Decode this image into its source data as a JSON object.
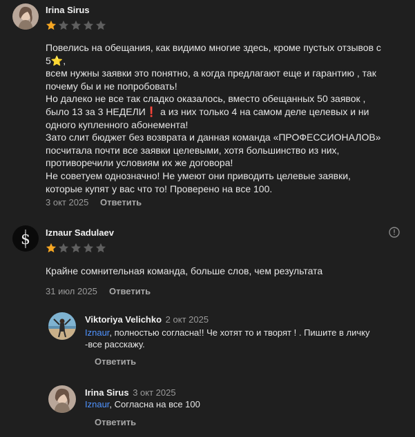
{
  "reviews": [
    {
      "author": "Irina Sirus",
      "rating": 1,
      "max_rating": 5,
      "lines": [
        "Повелись на обещания, как видимо многие здесь, кроме пустых отзывов с",
        "5⭐,",
        "всем нужны заявки это понятно, а когда предлагают еще и гарантию , так",
        "почему бы и не попробовать!",
        "Но далеко не все так сладко оказалось, вместо обещанных 50 заявок ,",
        "было 13 за 3 НЕДЕЛИ❗ а из них только 4 на самом деле целевых и ни",
        "одного купленного абонемента!",
        "Зато слит бюджет без возврата и данная команда «ПРОФЕССИОНАЛОВ»",
        "посчитала почти все заявки целевыми, хотя большинство из них,",
        "противоречили условиям их же договора!",
        "Не советуем однозначно! Не умеют они приводить целевые заявки,",
        "которые купят у вас что то! Проверено на все 100."
      ],
      "date": "3 окт 2025",
      "reply_label": "Ответить"
    },
    {
      "author": "Iznaur Sadulaev",
      "rating": 1,
      "max_rating": 5,
      "text": "Крайне сомнительная команда, больше слов, чем результата",
      "date": "31 июл 2025",
      "reply_label": "Ответить",
      "info_icon": "info-icon",
      "replies": [
        {
          "author": "Viktoriya Velichko",
          "date": "2 окт 2025",
          "mention": "Iznaur",
          "text": ", полностью согласна!! Че хотят то и творят ! . Пишите в личку",
          "text_line2": "-все расскажу.",
          "reply_label": "Ответить"
        },
        {
          "author": "Irina Sirus",
          "date": "3 окт 2025",
          "mention": "Iznaur",
          "text": ", Согласна на все 100",
          "reply_label": "Ответить"
        }
      ]
    }
  ],
  "colors": {
    "star_filled": "#f5a623",
    "star_empty": "#5f5f5f",
    "mention": "#4f93ff",
    "background": "#1f1f1f"
  }
}
